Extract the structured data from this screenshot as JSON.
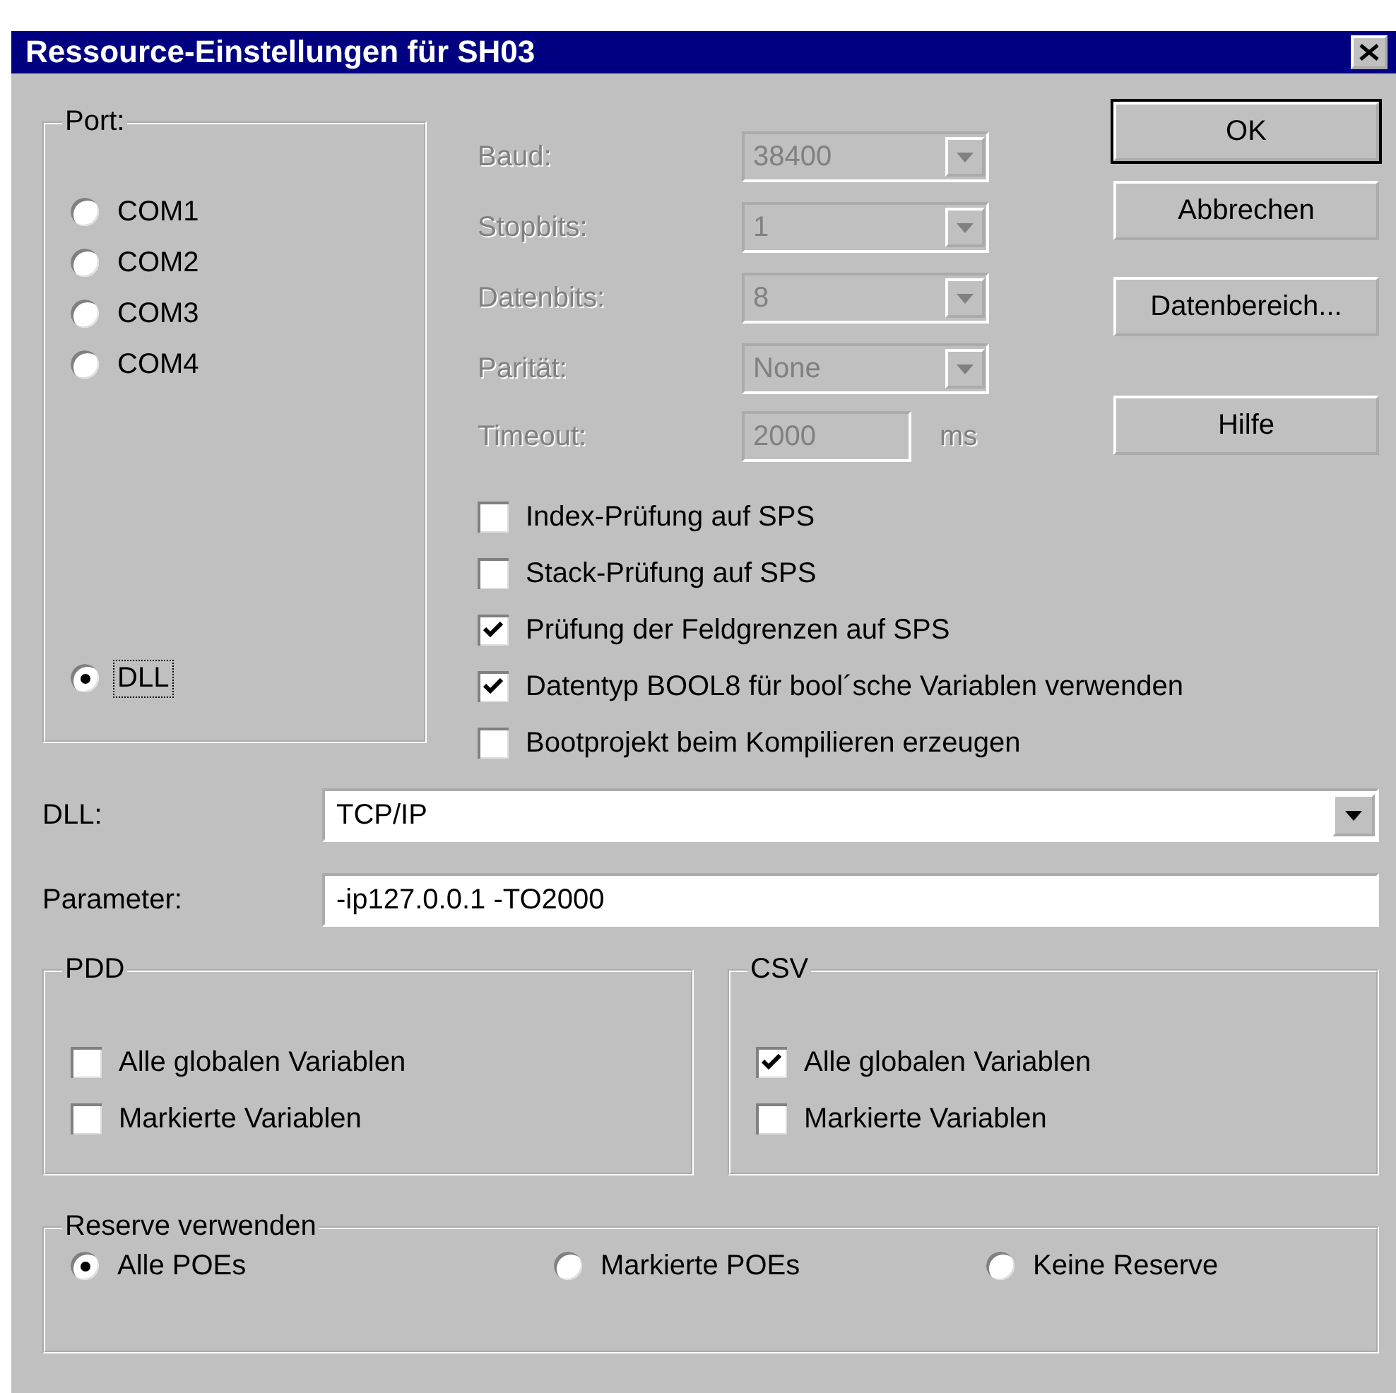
{
  "window": {
    "title": "Ressource-Einstellungen für SH03"
  },
  "port": {
    "label": "Port:",
    "options": [
      {
        "label": "COM1",
        "selected": false,
        "focused": false
      },
      {
        "label": "COM2",
        "selected": false,
        "focused": false
      },
      {
        "label": "COM3",
        "selected": false,
        "focused": false
      },
      {
        "label": "COM4",
        "selected": false,
        "focused": false
      },
      {
        "label": "DLL",
        "selected": true,
        "focused": true
      }
    ]
  },
  "settings": [
    {
      "label": "Baud:",
      "kind": "combo",
      "value": "38400",
      "disabled": true
    },
    {
      "label": "Stopbits:",
      "kind": "combo",
      "value": "1",
      "disabled": true
    },
    {
      "label": "Datenbits:",
      "kind": "combo",
      "value": "8",
      "disabled": true
    },
    {
      "label": "Parität:",
      "kind": "combo",
      "value": "None",
      "disabled": true
    },
    {
      "label": "Timeout:",
      "kind": "input",
      "value": "2000",
      "unit": "ms",
      "disabled": true
    }
  ],
  "options": [
    {
      "label": "Index-Prüfung auf SPS",
      "checked": false
    },
    {
      "label": "Stack-Prüfung auf SPS",
      "checked": false
    },
    {
      "label": "Prüfung der Feldgrenzen auf SPS",
      "checked": true
    },
    {
      "label": "Datentyp BOOL8 für bool´sche Variablen verwenden",
      "checked": true
    },
    {
      "label": "Bootprojekt beim Kompilieren erzeugen",
      "checked": false
    }
  ],
  "buttons": [
    {
      "label": "OK",
      "default": true
    },
    {
      "label": "Abbrechen",
      "default": false
    },
    {
      "label": "Datenbereich...",
      "default": false
    },
    {
      "label": "Hilfe",
      "default": false
    }
  ],
  "dll": {
    "label": "DLL:",
    "value": "TCP/IP"
  },
  "parameter": {
    "label": "Parameter:",
    "value": "-ip127.0.0.1 -TO2000"
  },
  "groups": [
    {
      "title": "PDD",
      "items": [
        {
          "label": "Alle globalen Variablen",
          "checked": false
        },
        {
          "label": "Markierte Variablen",
          "checked": false
        }
      ]
    },
    {
      "title": "CSV",
      "items": [
        {
          "label": "Alle globalen Variablen",
          "checked": true
        },
        {
          "label": "Markierte Variablen",
          "checked": false
        }
      ]
    }
  ],
  "reserve": {
    "title": "Reserve verwenden",
    "options": [
      {
        "label": "Alle POEs",
        "selected": true
      },
      {
        "label": "Markierte POEs",
        "selected": false
      },
      {
        "label": "Keine Reserve",
        "selected": false
      }
    ]
  }
}
